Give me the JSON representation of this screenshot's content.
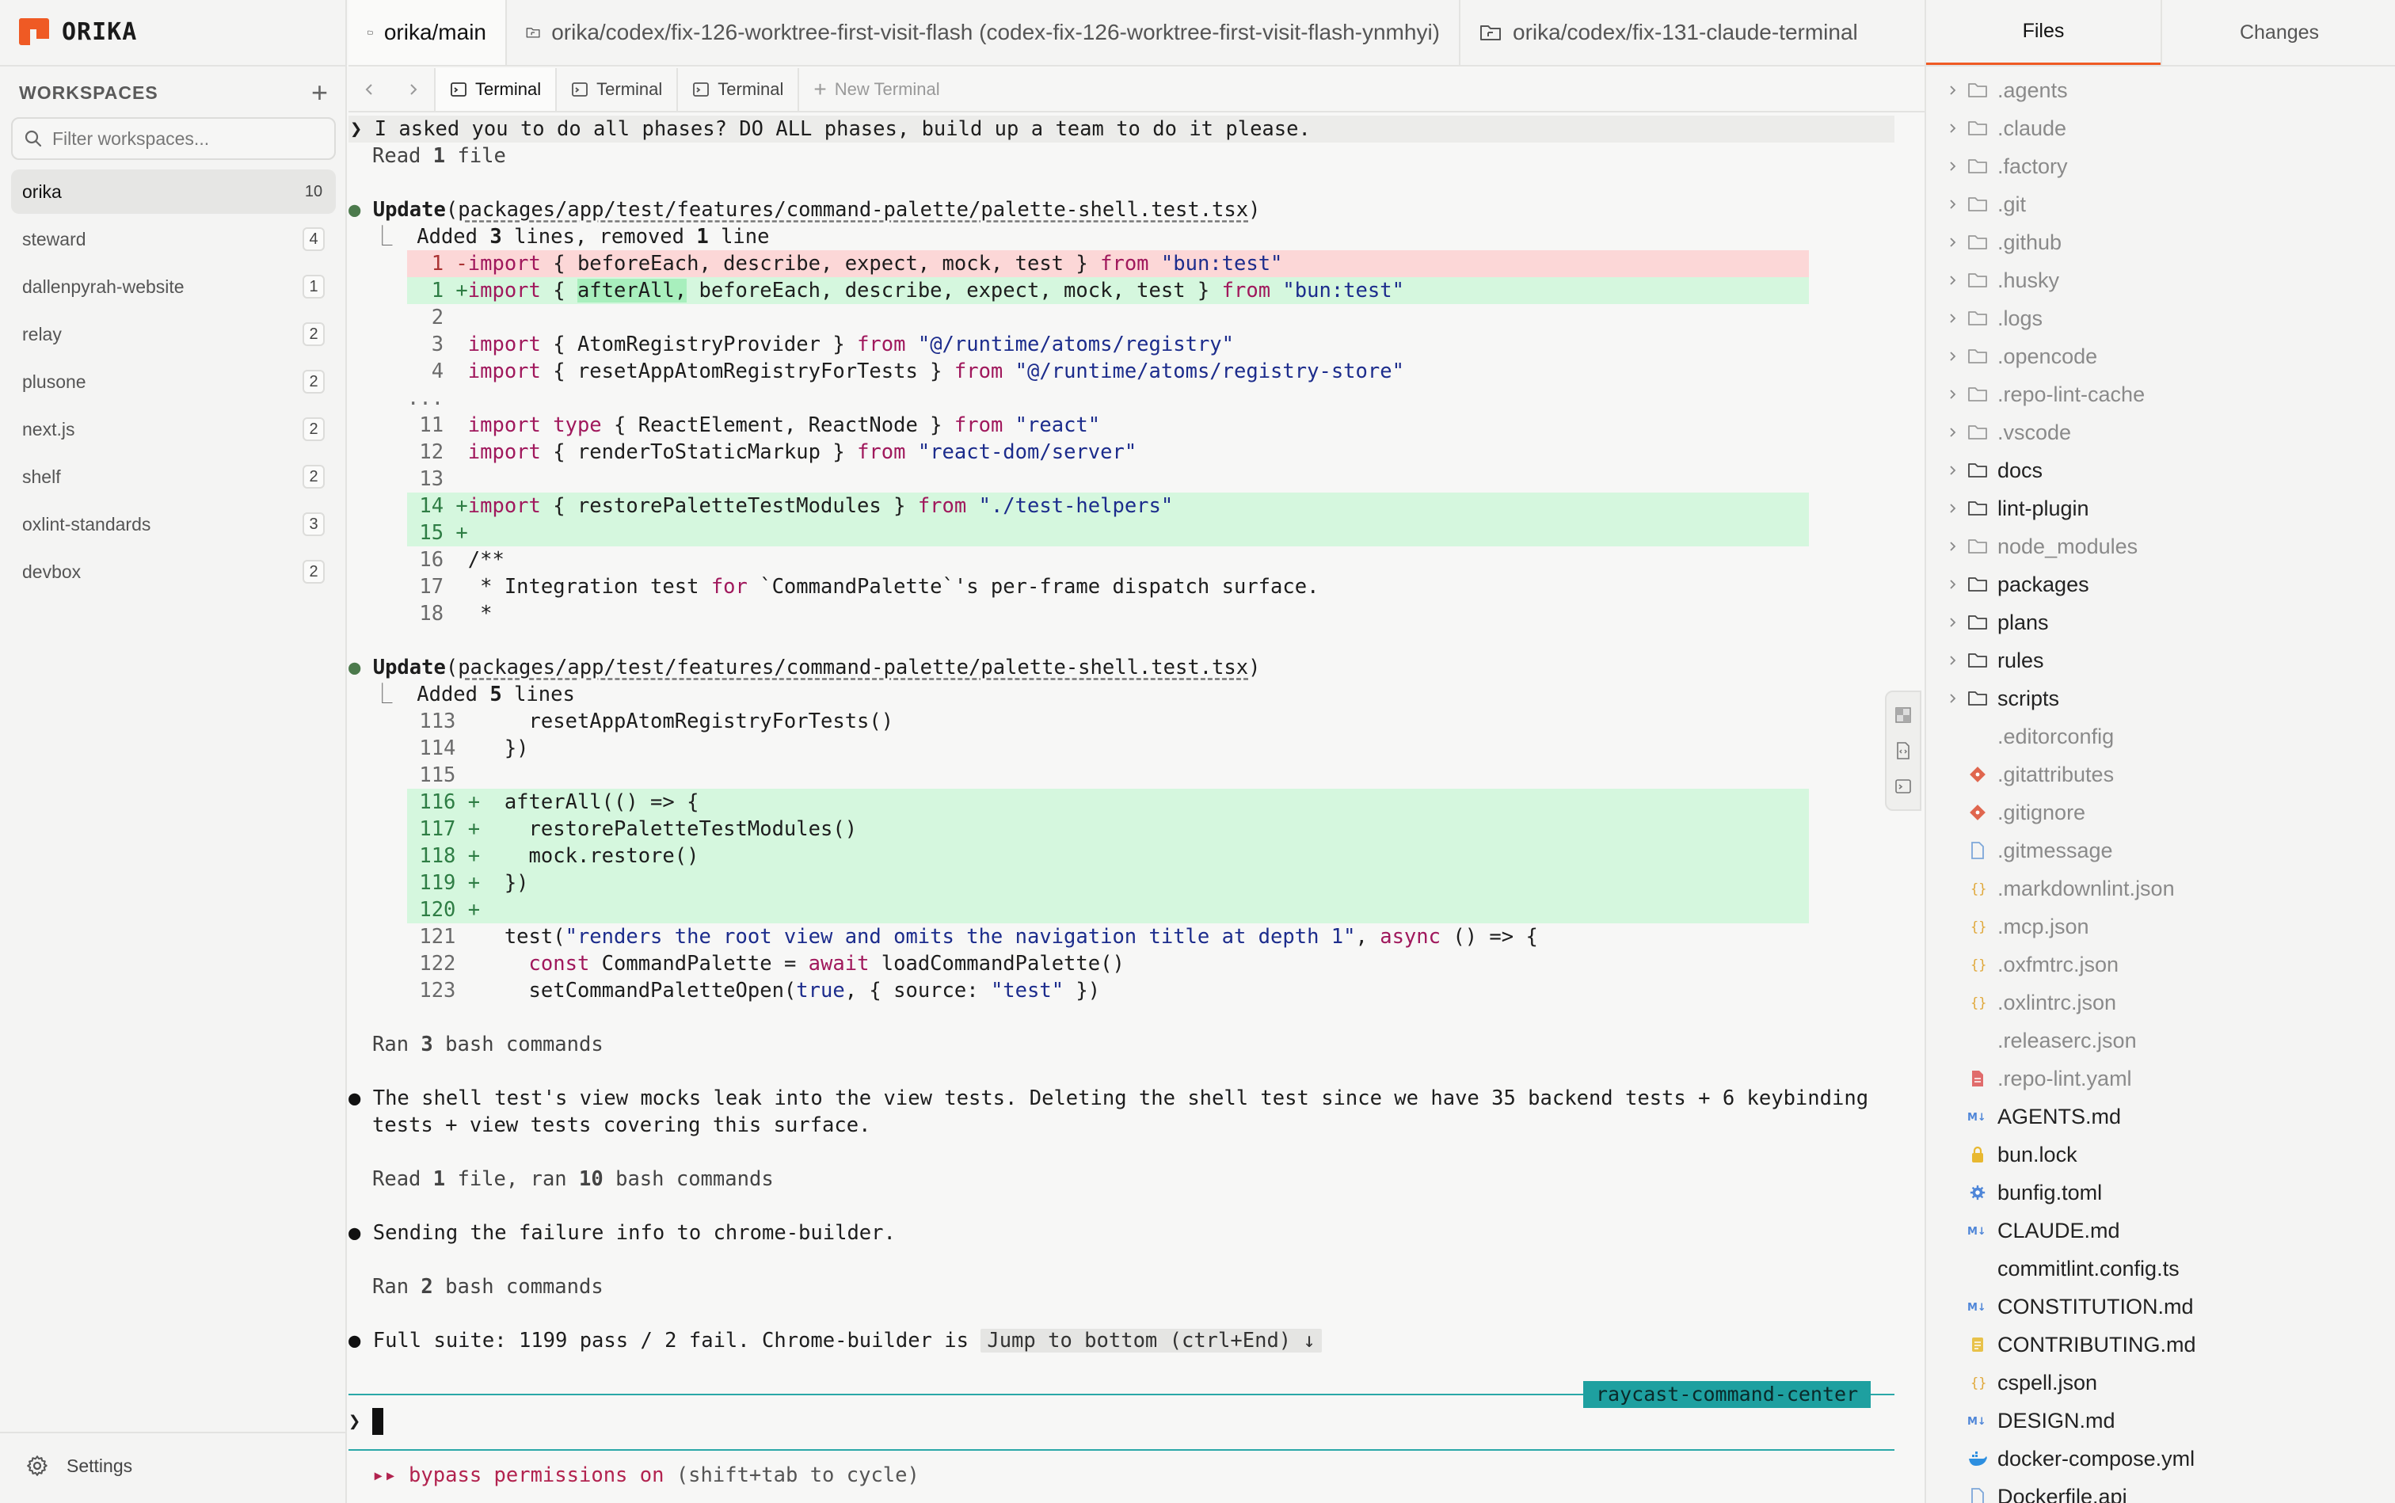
{
  "app": {
    "name": "ORIKA",
    "brand_color": "#ef5a24"
  },
  "sidebar": {
    "title": "WORKSPACES",
    "filter_placeholder": "Filter workspaces...",
    "settings_label": "Settings",
    "workspaces": [
      {
        "name": "orika",
        "count": "10",
        "active": true
      },
      {
        "name": "steward",
        "count": "4"
      },
      {
        "name": "dallenpyrah-website",
        "count": "1"
      },
      {
        "name": "relay",
        "count": "2"
      },
      {
        "name": "plusone",
        "count": "2"
      },
      {
        "name": "next.js",
        "count": "2"
      },
      {
        "name": "shelf",
        "count": "2"
      },
      {
        "name": "oxlint-standards",
        "count": "3"
      },
      {
        "name": "devbox",
        "count": "2"
      }
    ]
  },
  "worktree_tabs": [
    {
      "label": "orika/main",
      "icon": "folder-icon",
      "active": true
    },
    {
      "label": "orika/codex/fix-126-worktree-first-visit-flash (codex-fix-126-worktree-first-visit-flash-ynmhyi)",
      "icon": "worktree-icon"
    },
    {
      "label": "orika/codex/fix-131-claude-terminal",
      "icon": "worktree-icon"
    }
  ],
  "terminal_tabs": [
    {
      "label": "Terminal",
      "active": true
    },
    {
      "label": "Terminal"
    },
    {
      "label": "Terminal"
    },
    {
      "label": "New Terminal",
      "is_new": true
    }
  ],
  "terminal": {
    "prompt_symbol": "❯",
    "user_message": "I asked you to do all phases? DO ALL phases, build up a team to do it please.",
    "read_summary_1_pre": "Read ",
    "read_summary_1_num": "1",
    "read_summary_1_post": " file",
    "update_1": {
      "verb": "Update",
      "path": "packages/app/test/features/command-palette/palette-shell.test.tsx",
      "summary_pre": "Added ",
      "summary_a": "3",
      "summary_mid": " lines, removed ",
      "summary_b": "1",
      "summary_post": " line"
    },
    "update_2": {
      "verb": "Update",
      "path": "packages/app/test/features/command-palette/palette-shell.test.tsx",
      "summary_pre": "Added ",
      "summary_a": "5",
      "summary_post": " lines"
    },
    "ran_1": {
      "pre": "Ran ",
      "num": "3",
      "post": " bash commands"
    },
    "message_1a": "The shell test's view mocks leak into the view tests. Deleting the shell test since we have 35 backend tests + 6 keybinding",
    "message_1b": "tests + view tests covering this surface.",
    "read_summary_2": {
      "pre": "Read ",
      "num1": "1",
      "mid": " file, ran ",
      "num2": "10",
      "post": " bash commands"
    },
    "message_2": "Sending the failure info to chrome-builder.",
    "ran_2": {
      "pre": "Ran ",
      "num": "2",
      "post": " bash commands"
    },
    "message_3": "Full suite: 1199 pass / 2 fail. Chrome-builder is",
    "jump_label": "Jump to bottom (ctrl+End) ↓",
    "session_badge": "raycast-command-center",
    "perm_prefix": "▸▸ bypass permissions on",
    "perm_hint": " (shift+tab to cycle)"
  },
  "diff_1": [
    {
      "type": "del",
      "ln": "1",
      "sign": " -",
      "code": "import { beforeEach, describe, expect, mock, test } from \"bun:test\""
    },
    {
      "type": "add",
      "ln": "1",
      "sign": " +",
      "code": "import { afterAll, beforeEach, describe, expect, mock, test } from \"bun:test\""
    },
    {
      "type": "ctx",
      "ln": "2",
      "sign": "  ",
      "code": ""
    },
    {
      "type": "ctx",
      "ln": "3",
      "sign": "  ",
      "code": "import { AtomRegistryProvider } from \"@/runtime/atoms/registry\""
    },
    {
      "type": "ctx",
      "ln": "4",
      "sign": "  ",
      "code": "import { resetAppAtomRegistryForTests } from \"@/runtime/atoms/registry-store\""
    },
    {
      "type": "ellipsis",
      "ln": "...",
      "sign": "",
      "code": ""
    },
    {
      "type": "ctx",
      "ln": "11",
      "sign": "  ",
      "code": "import type { ReactElement, ReactNode } from \"react\""
    },
    {
      "type": "ctx",
      "ln": "12",
      "sign": "  ",
      "code": "import { renderToStaticMarkup } from \"react-dom/server\""
    },
    {
      "type": "ctx",
      "ln": "13",
      "sign": "  ",
      "code": ""
    },
    {
      "type": "add",
      "ln": "14",
      "sign": " +",
      "code": "import { restorePaletteTestModules } from \"./test-helpers\""
    },
    {
      "type": "add",
      "ln": "15",
      "sign": " +",
      "code": ""
    },
    {
      "type": "ctx",
      "ln": "16",
      "sign": "  ",
      "code": "/**"
    },
    {
      "type": "ctx",
      "ln": "17",
      "sign": "  ",
      "code": " * Integration test for `CommandPalette`'s per-frame dispatch surface."
    },
    {
      "type": "ctx",
      "ln": "18",
      "sign": "  ",
      "code": " *"
    }
  ],
  "diff_2": [
    {
      "type": "ctx",
      "ln": "113",
      "sign": "  ",
      "code": "    resetAppAtomRegistryForTests()"
    },
    {
      "type": "ctx",
      "ln": "114",
      "sign": "  ",
      "code": "  })"
    },
    {
      "type": "ctx",
      "ln": "115",
      "sign": "  ",
      "code": ""
    },
    {
      "type": "add",
      "ln": "116",
      "sign": " +",
      "code": "  afterAll(() => {"
    },
    {
      "type": "add",
      "ln": "117",
      "sign": " +",
      "code": "    restorePaletteTestModules()"
    },
    {
      "type": "add",
      "ln": "118",
      "sign": " +",
      "code": "    mock.restore()"
    },
    {
      "type": "add",
      "ln": "119",
      "sign": " +",
      "code": "  })"
    },
    {
      "type": "add",
      "ln": "120",
      "sign": " +",
      "code": ""
    },
    {
      "type": "ctx",
      "ln": "121",
      "sign": "  ",
      "code": "  test(\"renders the root view and omits the navigation title at depth 1\", async () => {"
    },
    {
      "type": "ctx",
      "ln": "122",
      "sign": "  ",
      "code": "    const CommandPalette = await loadCommandPalette()"
    },
    {
      "type": "ctx",
      "ln": "123",
      "sign": "  ",
      "code": "    setCommandPaletteOpen(true, { source: \"test\" })"
    }
  ],
  "files_panel": {
    "tabs": [
      {
        "label": "Files",
        "active": true
      },
      {
        "label": "Changes"
      }
    ],
    "tree": [
      {
        "name": ".agents",
        "kind": "folder",
        "muted": true
      },
      {
        "name": ".claude",
        "kind": "folder",
        "muted": true
      },
      {
        "name": ".factory",
        "kind": "folder",
        "muted": true
      },
      {
        "name": ".git",
        "kind": "folder",
        "muted": true
      },
      {
        "name": ".github",
        "kind": "folder",
        "muted": true
      },
      {
        "name": ".husky",
        "kind": "folder",
        "muted": true
      },
      {
        "name": ".logs",
        "kind": "folder",
        "muted": true
      },
      {
        "name": ".opencode",
        "kind": "folder",
        "muted": true
      },
      {
        "name": ".repo-lint-cache",
        "kind": "folder",
        "muted": true
      },
      {
        "name": ".vscode",
        "kind": "folder",
        "muted": true
      },
      {
        "name": "docs",
        "kind": "folder"
      },
      {
        "name": "lint-plugin",
        "kind": "folder"
      },
      {
        "name": "node_modules",
        "kind": "folder",
        "muted": true
      },
      {
        "name": "packages",
        "kind": "folder"
      },
      {
        "name": "plans",
        "kind": "folder"
      },
      {
        "name": "rules",
        "kind": "folder"
      },
      {
        "name": "scripts",
        "kind": "folder"
      },
      {
        "name": ".editorconfig",
        "kind": "file",
        "icon": "none",
        "muted": true
      },
      {
        "name": ".gitattributes",
        "kind": "file",
        "icon": "git",
        "muted": true
      },
      {
        "name": ".gitignore",
        "kind": "file",
        "icon": "git",
        "muted": true
      },
      {
        "name": ".gitmessage",
        "kind": "file",
        "icon": "doc",
        "muted": true
      },
      {
        "name": ".markdownlint.json",
        "kind": "file",
        "icon": "json",
        "muted": true
      },
      {
        "name": ".mcp.json",
        "kind": "file",
        "icon": "json",
        "muted": true
      },
      {
        "name": ".oxfmtrc.json",
        "kind": "file",
        "icon": "json",
        "muted": true
      },
      {
        "name": ".oxlintrc.json",
        "kind": "file",
        "icon": "json",
        "muted": true
      },
      {
        "name": ".releaserc.json",
        "kind": "file",
        "icon": "none",
        "muted": true
      },
      {
        "name": ".repo-lint.yaml",
        "kind": "file",
        "icon": "yaml",
        "muted": true
      },
      {
        "name": "AGENTS.md",
        "kind": "file",
        "icon": "md"
      },
      {
        "name": "bun.lock",
        "kind": "file",
        "icon": "lock"
      },
      {
        "name": "bunfig.toml",
        "kind": "file",
        "icon": "gear"
      },
      {
        "name": "CLAUDE.md",
        "kind": "file",
        "icon": "md"
      },
      {
        "name": "commitlint.config.ts",
        "kind": "file",
        "icon": "none"
      },
      {
        "name": "CONSTITUTION.md",
        "kind": "file",
        "icon": "md"
      },
      {
        "name": "CONTRIBUTING.md",
        "kind": "file",
        "icon": "note"
      },
      {
        "name": "cspell.json",
        "kind": "file",
        "icon": "json"
      },
      {
        "name": "DESIGN.md",
        "kind": "file",
        "icon": "md"
      },
      {
        "name": "docker-compose.yml",
        "kind": "file",
        "icon": "docker"
      },
      {
        "name": "Dockerfile.api",
        "kind": "file",
        "icon": "doc"
      }
    ]
  },
  "colors": {
    "diff_add": "#d5f7de",
    "diff_del": "#fcd7d7",
    "keyword": "#a0185c",
    "string": "#1c2c8c",
    "accent_teal": "#1ea0a0",
    "permission": "#b2234f"
  }
}
